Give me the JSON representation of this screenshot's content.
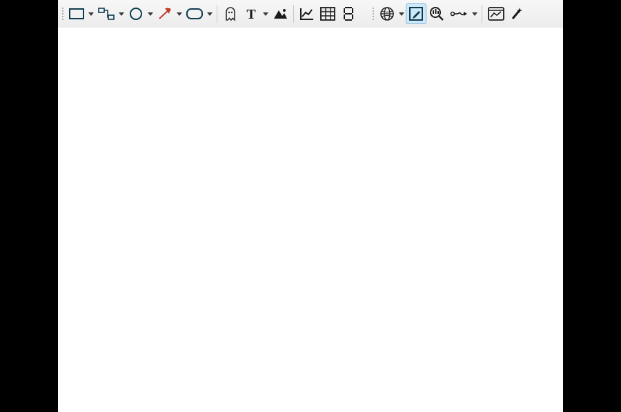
{
  "toolbar": {
    "groups": [
      {
        "name": "shapes",
        "items": [
          {
            "id": "rectangle",
            "icon": "rectangle-icon",
            "dropdown": true,
            "selected": false
          },
          {
            "id": "flow-connector",
            "icon": "connector-icon",
            "dropdown": true,
            "selected": false
          },
          {
            "id": "ellipse",
            "icon": "ellipse-icon",
            "dropdown": true,
            "selected": false
          },
          {
            "id": "arrow",
            "icon": "arrow-icon",
            "dropdown": true,
            "selected": false
          },
          {
            "id": "rounded-rect",
            "icon": "rounded-rect-icon",
            "dropdown": true,
            "selected": false
          }
        ]
      },
      {
        "name": "insert",
        "items": [
          {
            "id": "ghost",
            "icon": "ghost-icon",
            "dropdown": false,
            "selected": false
          },
          {
            "id": "text",
            "icon": "text-icon",
            "dropdown": true,
            "selected": false
          },
          {
            "id": "picture",
            "icon": "picture-icon",
            "dropdown": false,
            "selected": false
          }
        ]
      },
      {
        "name": "data",
        "items": [
          {
            "id": "chart",
            "icon": "chart-icon",
            "dropdown": false,
            "selected": false
          },
          {
            "id": "table",
            "icon": "table-icon",
            "dropdown": false,
            "selected": false
          },
          {
            "id": "digit",
            "icon": "digit-icon",
            "dropdown": false,
            "selected": false
          }
        ]
      },
      {
        "name": "web",
        "items": [
          {
            "id": "globe",
            "icon": "globe-icon",
            "dropdown": true,
            "selected": false
          },
          {
            "id": "edit",
            "icon": "edit-icon",
            "dropdown": false,
            "selected": true
          },
          {
            "id": "zoom",
            "icon": "zoom-icon",
            "dropdown": false,
            "selected": false
          },
          {
            "id": "flow-link",
            "icon": "flow-link-icon",
            "dropdown": true,
            "selected": false
          }
        ]
      },
      {
        "name": "view",
        "items": [
          {
            "id": "dashboard",
            "icon": "dashboard-icon",
            "dropdown": false,
            "selected": false
          },
          {
            "id": "wand",
            "icon": "wand-icon",
            "dropdown": false,
            "selected": false
          }
        ]
      }
    ]
  },
  "colors": {
    "stroke_navy": "#0d3b4d",
    "stroke_red": "#c0392b",
    "toolbar_bg": "#ececec",
    "selected_bg": "#cfe8f7"
  }
}
